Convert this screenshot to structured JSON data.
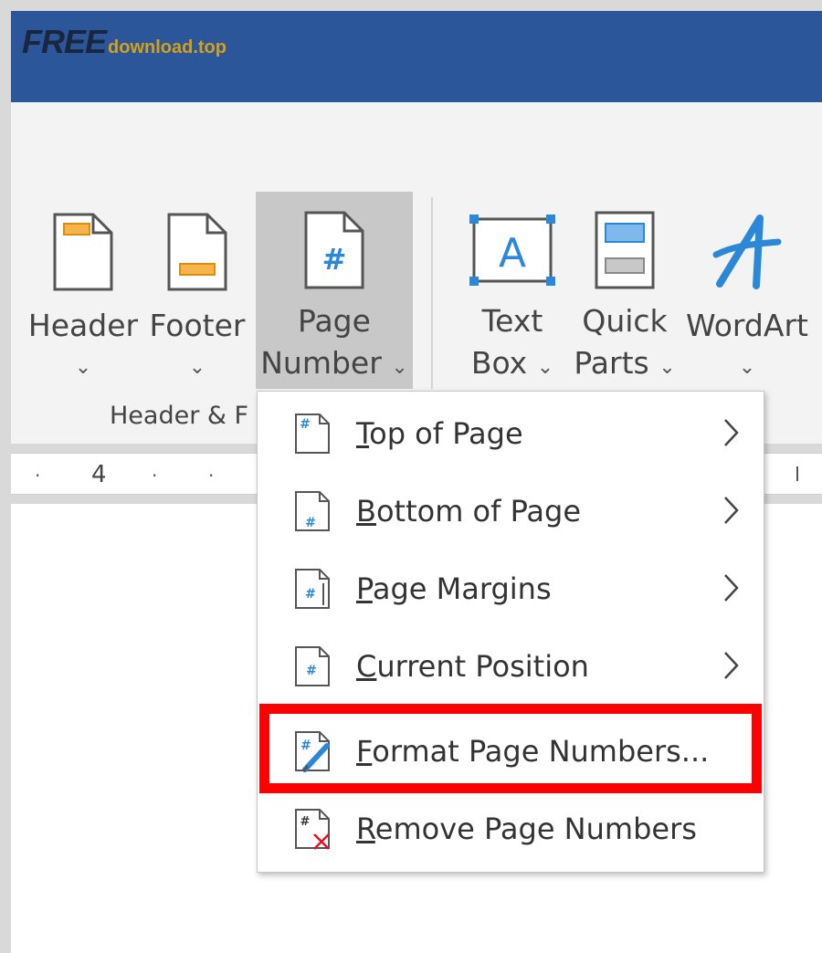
{
  "watermark": {
    "brand": "FREE",
    "suffix": "download.top"
  },
  "ribbon": {
    "buttons": [
      {
        "line1": "Header",
        "line2": ""
      },
      {
        "line1": "Footer",
        "line2": ""
      },
      {
        "line1": "Page",
        "line2": "Number"
      },
      {
        "line1": "Text",
        "line2": "Box"
      },
      {
        "line1": "Quick",
        "line2": "Parts"
      },
      {
        "line1": "WordArt",
        "line2": ""
      }
    ],
    "group_label": "Header & F",
    "chevron": "⌄"
  },
  "ruler": {
    "number": "4"
  },
  "menu": {
    "items": [
      {
        "pre": "",
        "key": "T",
        "post": "op of Page",
        "submenu": true,
        "icon": "top-of-page-icon"
      },
      {
        "pre": "",
        "key": "B",
        "post": "ottom of Page",
        "submenu": true,
        "icon": "bottom-of-page-icon"
      },
      {
        "pre": "",
        "key": "P",
        "post": "age Margins",
        "submenu": true,
        "icon": "page-margins-icon"
      },
      {
        "pre": "",
        "key": "C",
        "post": "urrent Position",
        "submenu": true,
        "icon": "current-position-icon"
      },
      {
        "pre": "",
        "key": "F",
        "post": "ormat Page Numbers...",
        "submenu": false,
        "icon": "format-page-numbers-icon"
      },
      {
        "pre": "",
        "key": "R",
        "post": "emove Page Numbers",
        "submenu": false,
        "icon": "remove-page-numbers-icon"
      }
    ]
  },
  "colors": {
    "title_bar": "#2b579a",
    "accent_orange": "#f0a030",
    "accent_blue": "#2b88d8",
    "highlight": "#ff0000"
  }
}
